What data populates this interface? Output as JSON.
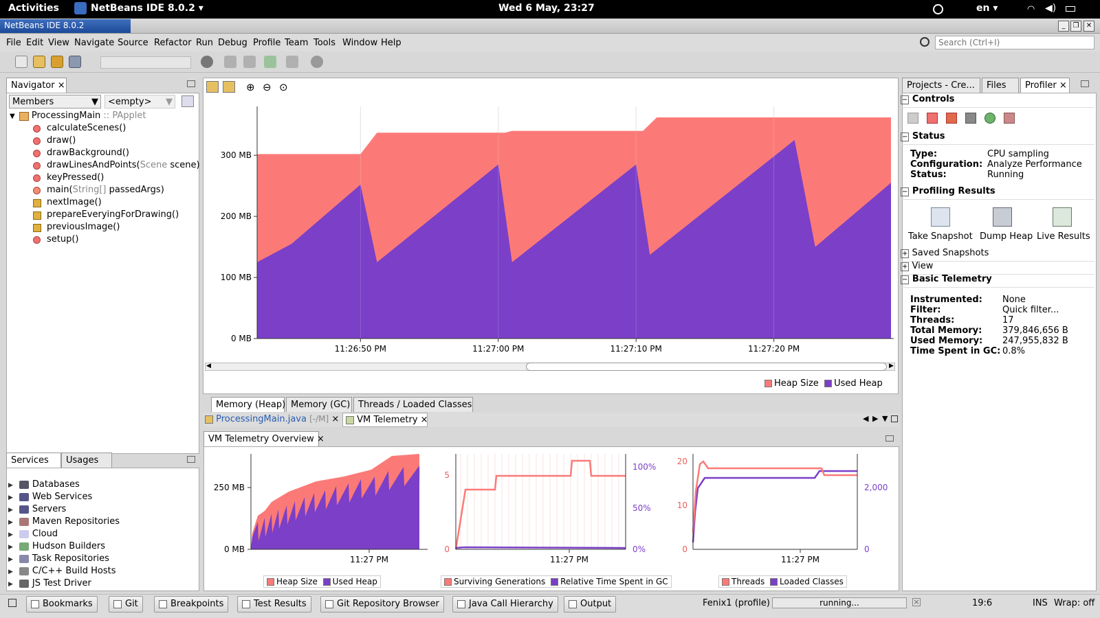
{
  "topbar": {
    "activities": "Activities",
    "app_menu": "NetBeans IDE 8.0.2 ▾",
    "clock": "Wed  6 May, 23:27",
    "lang": "en ▾"
  },
  "window": {
    "title": "NetBeans IDE 8.0.2"
  },
  "menu": [
    "File",
    "Edit",
    "View",
    "Navigate",
    "Source",
    "Refactor",
    "Run",
    "Debug",
    "Profile",
    "Team",
    "Tools",
    "Window",
    "Help"
  ],
  "search": {
    "placeholder": "Search (Ctrl+I)"
  },
  "navigator": {
    "tab": "Navigator",
    "filter": "Members",
    "filter2": "<empty>",
    "class_name": "ProcessingMain",
    "class_sep": " :: ",
    "class_parent": "PApplet",
    "members": [
      {
        "name": "calculateScenes()",
        "kind": "method"
      },
      {
        "name": "draw()",
        "kind": "method"
      },
      {
        "name": "drawBackground()",
        "kind": "method"
      },
      {
        "name": "drawLinesAndPoints(",
        "type": "Scene",
        "rest": " scene)",
        "kind": "mixed"
      },
      {
        "name": "keyPressed()",
        "kind": "method"
      },
      {
        "name": "main(",
        "type": "String[]",
        "rest": " passedArgs)",
        "kind": "static"
      },
      {
        "name": "nextImage()",
        "kind": "private"
      },
      {
        "name": "prepareEveryingForDrawing()",
        "kind": "private"
      },
      {
        "name": "previousImage()",
        "kind": "private"
      },
      {
        "name": "setup()",
        "kind": "method"
      }
    ]
  },
  "services": {
    "tabs": [
      "Services",
      "Usages"
    ],
    "items": [
      "Databases",
      "Web Services",
      "Servers",
      "Maven Repositories",
      "Cloud",
      "Hudson Builders",
      "Task Repositories",
      "C/C++ Build Hosts",
      "JS Test Driver"
    ]
  },
  "main_chart": {
    "legend": [
      "Heap Size",
      "Used Heap"
    ],
    "tabs": [
      "Memory (Heap)",
      "Memory (GC)",
      "Threads / Loaded Classes"
    ]
  },
  "editor_tabs": [
    {
      "label": "ProcessingMain.java",
      "suffix": "[-/M]"
    },
    {
      "label": "VM Telemetry"
    }
  ],
  "telemetry": {
    "title": "VM Telemetry Overview"
  },
  "right_panel": {
    "tabs": [
      "Projects - Cre...",
      "Files",
      "Profiler"
    ],
    "controls_title": "Controls",
    "status_title": "Status",
    "status": [
      {
        "k": "Type:",
        "v": "CPU sampling"
      },
      {
        "k": "Configuration:",
        "v": "Analyze Performance"
      },
      {
        "k": "Status:",
        "v": "Running"
      }
    ],
    "results_title": "Profiling Results",
    "results_buttons": [
      "Take Snapshot",
      "Dump Heap",
      "Live Results"
    ],
    "saved_snapshots": "Saved Snapshots",
    "view": "View",
    "basic_title": "Basic Telemetry",
    "basic": [
      {
        "k": "Instrumented:",
        "v": "None"
      },
      {
        "k": "Filter:",
        "v": "Quick filter..."
      },
      {
        "k": "Threads:",
        "v": "17"
      },
      {
        "k": "Total Memory:",
        "v": "379,846,656 B"
      },
      {
        "k": "Used Memory:",
        "v": "247,955,832 B"
      },
      {
        "k": "Time Spent in GC:",
        "v": "0.8%"
      }
    ]
  },
  "bottom_tabs": [
    "Bookmarks",
    "Git",
    "Breakpoints",
    "Test Results",
    "Git Repository Browser",
    "Java Call Hierarchy",
    "Output"
  ],
  "statusbar": {
    "process": "Fenix1 (profile)",
    "progress": "running...",
    "position": "19:6",
    "mode": "INS",
    "wrap": "Wrap: off"
  },
  "colors": {
    "heap": "#fb7a78",
    "used": "#7b3fc8",
    "accent": "#2a5db0"
  },
  "chart_data": [
    {
      "type": "area",
      "title": "",
      "ylabel": "",
      "ylim": [
        0,
        380
      ],
      "y_unit": "MB",
      "yticks": [
        "0 MB",
        "100 MB",
        "200 MB",
        "300 MB"
      ],
      "ytick_values": [
        0,
        100,
        200,
        300
      ],
      "xticks": [
        "11:26:50 PM",
        "11:27:00 PM",
        "11:27:10 PM",
        "11:27:20 PM"
      ],
      "xtick_values": [
        10,
        20,
        30,
        40
      ],
      "xlim": [
        2.5,
        48.5
      ],
      "series": [
        {
          "name": "Heap Size",
          "color": "#fb7a78",
          "x": [
            2.5,
            10,
            11.2,
            20.5,
            21,
            30.5,
            31.5,
            48.5
          ],
          "values": [
            302,
            302,
            337,
            337,
            340,
            340,
            362,
            362
          ]
        },
        {
          "name": "Used Heap",
          "color": "#7b3fc8",
          "x": [
            2.5,
            5,
            10,
            11.2,
            20,
            21,
            30,
            31,
            41.5,
            43,
            48.5
          ],
          "values": [
            125,
            155,
            252,
            125,
            285,
            125,
            285,
            137,
            325,
            150,
            255
          ]
        }
      ]
    },
    {
      "type": "area",
      "title": "",
      "ylim": [
        0,
        380
      ],
      "yticks": [
        "0 MB",
        "250 MB"
      ],
      "ytick_values": [
        0,
        250
      ],
      "xticks": [
        "11:27 PM"
      ],
      "legend": [
        "Heap Size",
        "Used Heap"
      ]
    },
    {
      "type": "line",
      "yticks_left": [
        "0",
        "5"
      ],
      "yticks_right": [
        "0%",
        "50%",
        "100%"
      ],
      "xticks": [
        "11:27 PM"
      ],
      "legend": [
        "Surviving Generations",
        "Relative Time Spent in GC"
      ]
    },
    {
      "type": "line",
      "yticks_left": [
        "0",
        "10",
        "20"
      ],
      "yticks_right": [
        "0",
        "2,000"
      ],
      "xticks": [
        "11:27 PM"
      ],
      "legend": [
        "Threads",
        "Loaded Classes"
      ]
    }
  ]
}
